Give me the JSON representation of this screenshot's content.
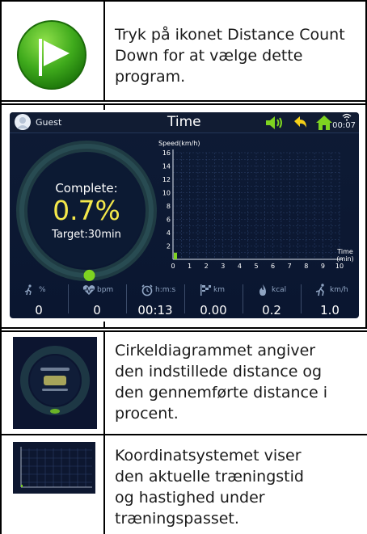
{
  "row1": {
    "icon": "flag-play-icon",
    "text_lines": [
      "Tryk på ikonet Distance Count",
      "Down for at vælge dette",
      "program."
    ]
  },
  "screen": {
    "user": "Guest",
    "title": "Time",
    "clock": "00:07",
    "icons": [
      "avatar-icon",
      "speaker-icon",
      "back-arrow-icon",
      "home-icon",
      "wifi-icon"
    ],
    "progress": {
      "label": "Complete:",
      "value": "0.7%",
      "target": "Target:30min",
      "fraction": 0.007
    },
    "stats": [
      {
        "icon": "runner-icon",
        "unit": "%",
        "value": "0"
      },
      {
        "icon": "heart-icon",
        "unit": "bpm",
        "value": "0"
      },
      {
        "icon": "alarm-clock-icon",
        "unit": "h:m:s",
        "value": "00:13"
      },
      {
        "icon": "checkered-flag-icon",
        "unit": "km",
        "value": "0.00"
      },
      {
        "icon": "flame-icon",
        "unit": "kcal",
        "value": "0.2"
      },
      {
        "icon": "speed-runner-icon",
        "unit": "km/h",
        "value": "1.0"
      }
    ],
    "colors": {
      "accent_green": "#5cc227",
      "value_yellow": "#f4e84a",
      "bg": "#0e1b35"
    }
  },
  "chart_data": {
    "type": "bar",
    "ylabel": "Speed(km/h)",
    "xlabel": "Time (min)",
    "x_ticks": [
      "0",
      "1",
      "2",
      "3",
      "4",
      "5",
      "6",
      "7",
      "8",
      "9",
      "10"
    ],
    "y_ticks": [
      "2",
      "4",
      "6",
      "8",
      "10",
      "12",
      "14",
      "16"
    ],
    "xlim": [
      0,
      10
    ],
    "ylim": [
      0,
      16
    ],
    "grid": true,
    "series": [
      {
        "values": [
          {
            "x": 0.1,
            "y": 1.0
          }
        ]
      }
    ]
  },
  "row3": {
    "thumb_icon": "circle-chart-thumbnail",
    "text_lines": [
      "Cirkeldiagrammet angiver",
      "den indstillede distance og",
      "den gennemførte distance i",
      "procent."
    ]
  },
  "row4": {
    "thumb_icon": "coordinate-chart-thumbnail",
    "text_lines": [
      "Koordinatsystemet viser",
      "den aktuelle træningstid",
      "og hastighed under",
      "træningspasset."
    ]
  }
}
